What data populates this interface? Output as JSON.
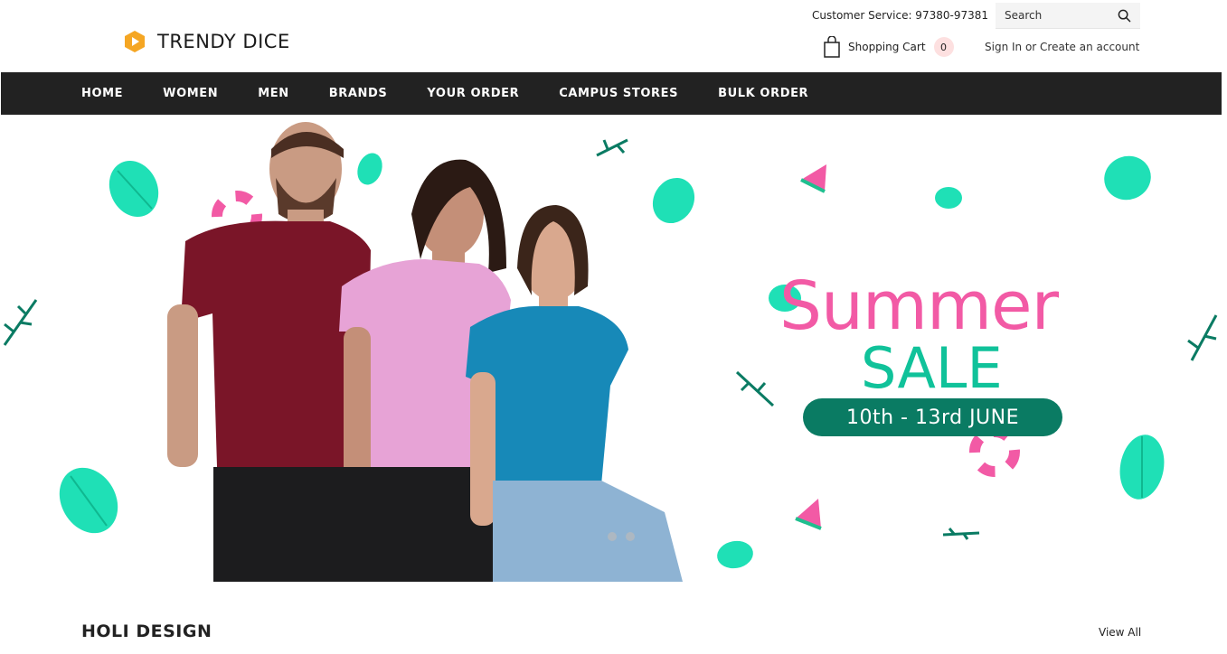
{
  "brand": {
    "name": "TRENDY DICE"
  },
  "header": {
    "customer_service": "Customer Service: 97380-97381",
    "search_placeholder": "Search",
    "cart_label": "Shopping Cart",
    "cart_count": "0",
    "sign_in": "Sign In",
    "or": " or ",
    "create_account": "Create an account"
  },
  "nav": {
    "items": [
      "HOME",
      "WOMEN",
      "MEN",
      "BRANDS",
      "YOUR ORDER",
      "CAMPUS STORES",
      "BULK ORDER"
    ]
  },
  "banner": {
    "headline_1": "Summer",
    "headline_2": "SALE",
    "dates": "10th - 13rd JUNE",
    "slide_count": 2,
    "colors": {
      "pink": "#f25aa5",
      "green": "#10c29a",
      "dark_green": "#0a7b63"
    }
  },
  "section": {
    "title": "HOLI DESIGN",
    "view_all": "View All"
  },
  "colors": {
    "nav_bg": "#222222",
    "logo_accent": "#f5a623"
  }
}
